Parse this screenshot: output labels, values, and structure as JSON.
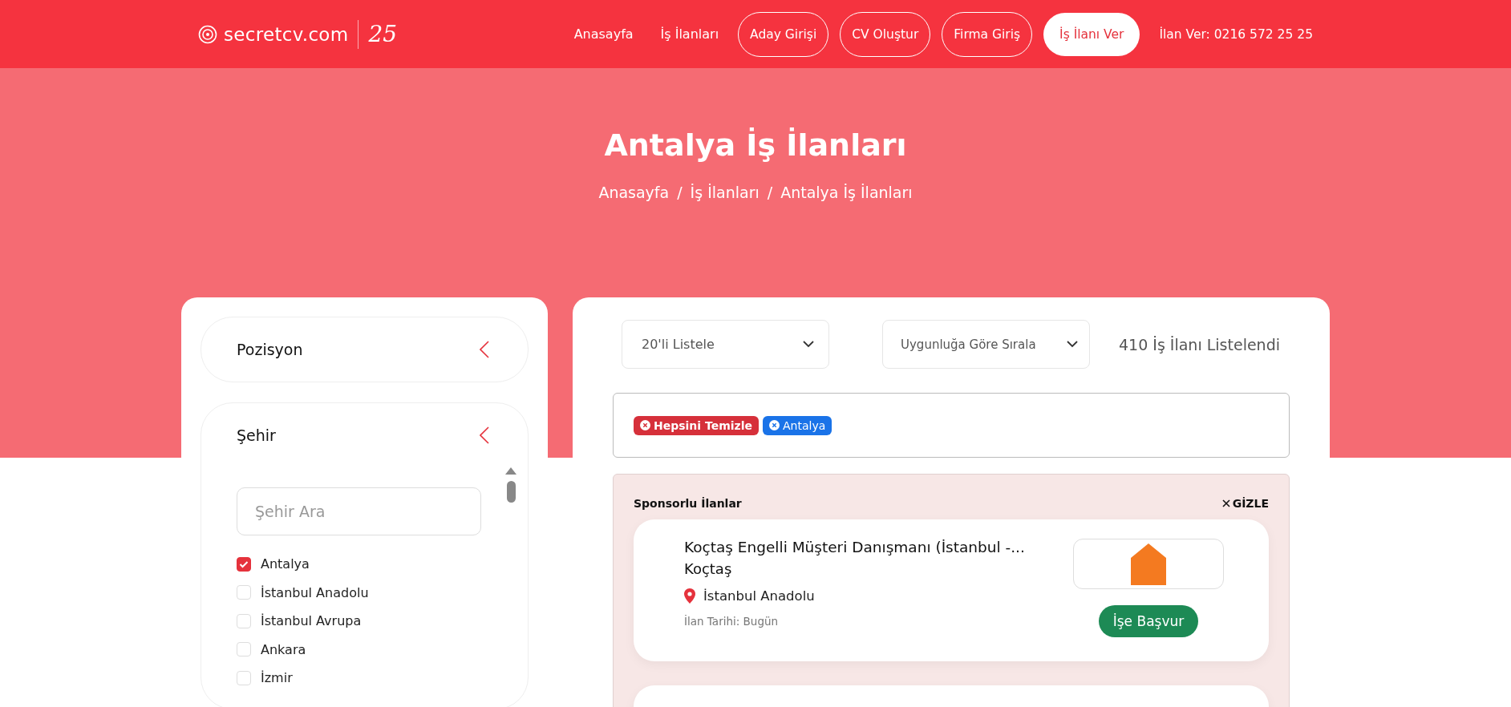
{
  "header": {
    "logo_text": "secretcv.com",
    "logo_badge": "25",
    "nav": [
      {
        "label": "Anasayfa",
        "kind": "link"
      },
      {
        "label": "İş İlanları",
        "kind": "link"
      },
      {
        "label": "Aday Girişi",
        "kind": "outline"
      },
      {
        "label": "CV Oluştur",
        "kind": "outline"
      },
      {
        "label": "Firma Giriş",
        "kind": "outline"
      },
      {
        "label": "İş İlanı Ver",
        "kind": "filled"
      }
    ],
    "phone": "İlan Ver: 0216 572 25 25"
  },
  "hero": {
    "title": "Antalya İş İlanları",
    "breadcrumb": [
      "Anasayfa",
      "İş İlanları",
      "Antalya İş İlanları"
    ],
    "separator": "/"
  },
  "filters": [
    {
      "title": "Pozisyon",
      "expanded": false
    },
    {
      "title": "Şehir",
      "expanded": true,
      "placeholder": "Şehir Ara",
      "options": [
        {
          "label": "Antalya",
          "checked": true
        },
        {
          "label": "İstanbul Anadolu",
          "checked": false
        },
        {
          "label": "İstanbul Avrupa",
          "checked": false
        },
        {
          "label": "Ankara",
          "checked": false
        },
        {
          "label": "İzmir",
          "checked": false
        }
      ]
    }
  ],
  "results": {
    "page_size": "20'li Listele",
    "sort": "Uygunluğa Göre Sırala",
    "count": "410 İş İlanı Listelendi",
    "active_filters": [
      {
        "label": "Hepsini Temizle",
        "kind": "clear_all"
      },
      {
        "label": "Antalya",
        "kind": "filter"
      }
    ],
    "sponsored": {
      "title": "Sponsorlu İlanlar",
      "hide": "GİZLE",
      "jobs": [
        {
          "title": "Koçtaş Engelli Müşteri Danışmanı (İstanbul -...",
          "company": "Koçtaş",
          "location": "İstanbul Anadolu",
          "date": "İlan Tarihi: Bugün",
          "apply": "İşe Başvur"
        }
      ]
    }
  }
}
